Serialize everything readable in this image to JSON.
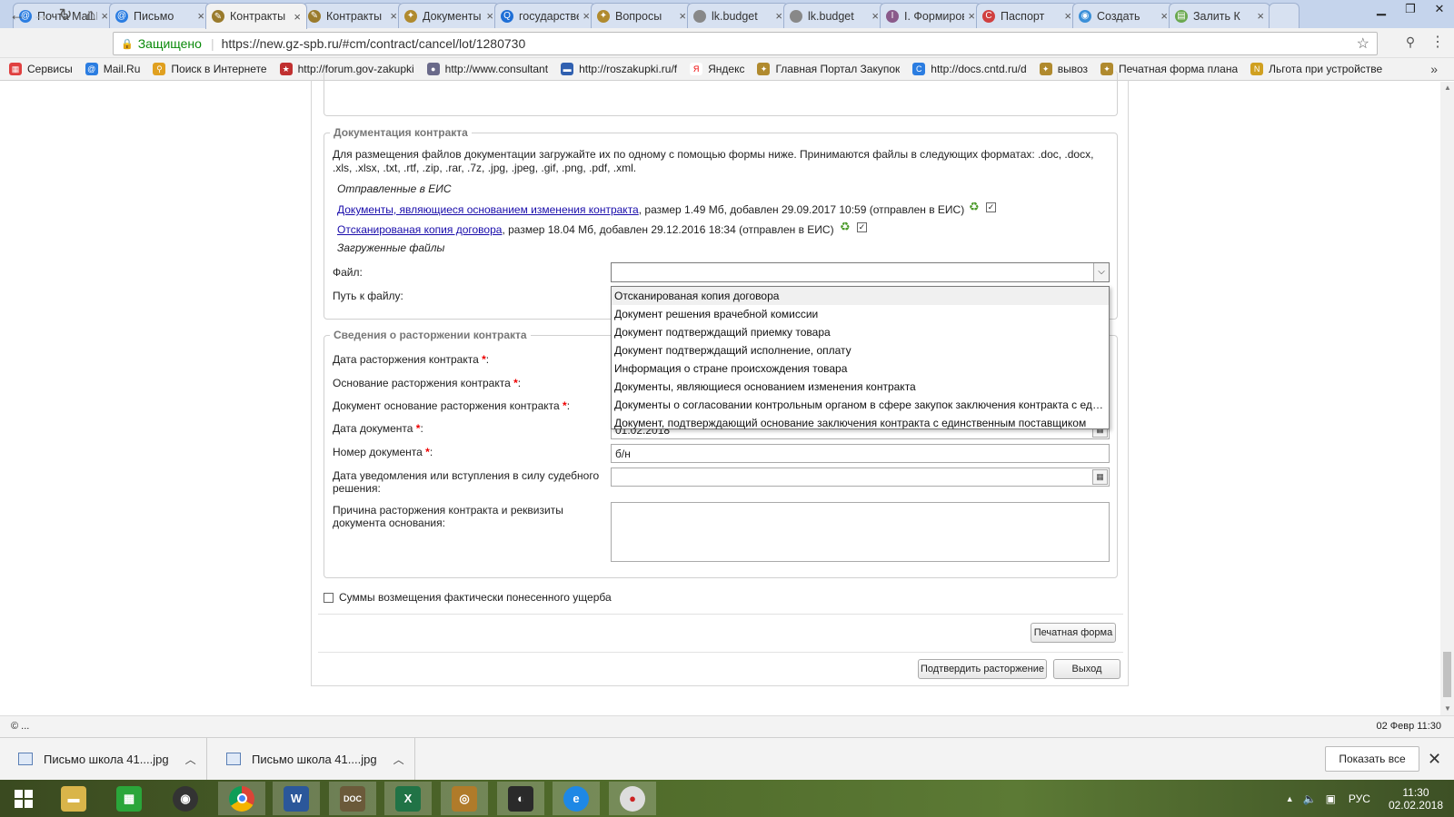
{
  "browser": {
    "tabs": [
      {
        "label": "Почта Mail.Ru",
        "color": "#2b7de1",
        "glyph": "@"
      },
      {
        "label": "Письмо",
        "color": "#2b7de1",
        "glyph": "@"
      },
      {
        "label": "Контракты",
        "color": "#9a7b2c",
        "glyph": "✎",
        "active": true
      },
      {
        "label": "Контракты",
        "color": "#9a7b2c",
        "glyph": "✎"
      },
      {
        "label": "Документы",
        "color": "#b08a2e",
        "glyph": "✦"
      },
      {
        "label": "государственные",
        "color": "#1f6fd6",
        "glyph": "Q"
      },
      {
        "label": "Вопросы",
        "color": "#b08a2e",
        "glyph": "✦"
      },
      {
        "label": "lk.budget",
        "color": "#888888",
        "glyph": ""
      },
      {
        "label": "lk.budget",
        "color": "#888888",
        "glyph": ""
      },
      {
        "label": "I. Формирование",
        "color": "#8a5a8a",
        "glyph": "I"
      },
      {
        "label": "Паспорт",
        "color": "#d04040",
        "glyph": "C"
      },
      {
        "label": "Создать",
        "color": "#3a8fd8",
        "glyph": "◉"
      },
      {
        "label": "Залить К",
        "color": "#6aa84f",
        "glyph": "▤"
      }
    ],
    "url_secure_label": "Защищено",
    "url": "https://new.gz-spb.ru/#cm/contract/cancel/lot/1280730",
    "bookmarks": [
      {
        "label": "Сервисы",
        "color": "#e04040",
        "glyph": "▦"
      },
      {
        "label": "Mail.Ru",
        "color": "#2b7de1",
        "glyph": "@"
      },
      {
        "label": "Поиск в Интернете",
        "color": "#e0a020",
        "glyph": "⚲"
      },
      {
        "label": "http://forum.gov-zakupki",
        "color": "#c03030",
        "glyph": "★"
      },
      {
        "label": "http://www.consultant",
        "color": "#6a6a8a",
        "glyph": "●"
      },
      {
        "label": "http://roszakupki.ru/f",
        "color": "#3060b0",
        "glyph": "▬"
      },
      {
        "label": "Яндекс",
        "color": "#ffffff",
        "glyph": "Я"
      },
      {
        "label": "Главная Портал Закупок",
        "color": "#b08a2e",
        "glyph": "✦"
      },
      {
        "label": "http://docs.cntd.ru/d",
        "color": "#2b7de1",
        "glyph": "C"
      },
      {
        "label": "вывоз",
        "color": "#b08a2e",
        "glyph": "✦"
      },
      {
        "label": "Печатная форма плана",
        "color": "#b08a2e",
        "glyph": "✦"
      },
      {
        "label": "Льгота при устройстве",
        "color": "#d0a020",
        "glyph": "N"
      }
    ],
    "more_bookmarks": "»"
  },
  "form": {
    "doc_section_legend": "Документация контракта",
    "doc_hint_line1": "Для размещения файлов документации загружайте их по одному с помощью формы ниже. Принимаются файлы в следующих форматах: .doc, .docx,",
    "doc_hint_line2": ".xls, .xlsx, .txt, .rtf, .zip, .rar, .7z, .jpg, .jpeg, .gif, .png, .pdf, .xml.",
    "sent_label": "Отправленные в ЕИС",
    "sent_files": [
      {
        "link": "Документы, являющиеся основанием изменения контракта",
        "meta": ", размер 1.49 Мб, добавлен 29.09.2017 10:59 (отправлен в ЕИС)"
      },
      {
        "link": "Отсканированая копия договора",
        "meta": ", размер 18.04 Мб, добавлен 29.12.2016 18:34 (отправлен в ЕИС)"
      }
    ],
    "uploaded_label": "Загруженные файлы",
    "file_label": "Файл:",
    "path_label": "Путь к файлу:",
    "file_options": [
      "Отсканированая копия договора",
      "Документ решения врачебной комиссии",
      "Документ подтверждащий приемку товара",
      "Документ подтверждащий исполнение, оплату",
      "Информация о стране происхождения товара",
      "Документы, являющиеся основанием изменения контракта",
      "Документы о согласовании контрольным органом в сфере закупок заключения контракта с единственным поставщиком",
      "Документ, подтверждающий основание заключения контракта с единственным поставщиком"
    ],
    "termination_legend": "Сведения о расторжении контракта",
    "termination_date_label": "Дата расторжения контракта",
    "termination_basis_label": "Основание расторжения контракта",
    "termination_doc_label": "Документ основание расторжения контракта",
    "doc_date_label": "Дата документа",
    "doc_date_value": "01.02.2018",
    "doc_number_label": "Номер документа",
    "doc_number_value": "б/н",
    "notice_date_label_1": "Дата уведомления или вступления в силу судебного",
    "notice_date_label_2": "решения:",
    "reason_label_1": "Причина расторжения контракта и реквизиты",
    "reason_label_2": "документа основания:",
    "required_mark": "*",
    "damages_label": "Суммы возмещения фактически понесенного ущерба",
    "print_button": "Печатная форма",
    "confirm_button": "Подтвердить расторжение",
    "exit_button": "Выход"
  },
  "statusbar": {
    "left": "© ...",
    "right": "02 Февр 11:30"
  },
  "downloads": {
    "items": [
      "Письмо школа 41....jpg",
      "Письмо школа 41....jpg"
    ],
    "show_all": "Показать все"
  },
  "taskbar": {
    "lang": "РУС",
    "time": "11:30",
    "date": "02.02.2018"
  }
}
